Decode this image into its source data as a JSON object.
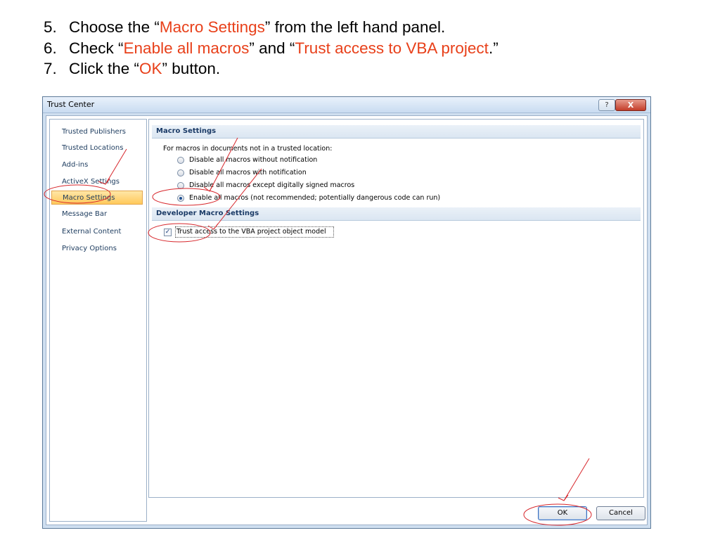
{
  "instructions": [
    {
      "num": "5.",
      "before": "Choose the “",
      "highlight": "Macro Settings",
      "after": "” from the left hand panel."
    },
    {
      "num": "6.",
      "before": "Check “",
      "highlight": "Enable all macros",
      "middle": "” and “",
      "highlight2": "Trust access to VBA project",
      "after": ".”"
    },
    {
      "num": "7.",
      "before": "Click the “",
      "highlight": "OK",
      "after": "” button."
    }
  ],
  "dialog": {
    "title": "Trust Center",
    "help_glyph": "?",
    "close_glyph": "X",
    "nav_items": [
      "Trusted Publishers",
      "Trusted Locations",
      "Add-ins",
      "ActiveX Settings",
      "Macro Settings",
      "Message Bar",
      "External Content",
      "Privacy Options"
    ],
    "selected_nav": "Macro Settings",
    "macro_section_title": "Macro Settings",
    "macro_intro": "For macros in documents not in a trusted location:",
    "macro_options": [
      {
        "label": "Disable all macros without notification",
        "selected": false
      },
      {
        "label": "Disable all macros with notification",
        "selected": false
      },
      {
        "label": "Disable all macros except digitally signed macros",
        "selected": false
      },
      {
        "label": "Enable all macros (not recommended; potentially dangerous code can run)",
        "selected": true
      }
    ],
    "developer_section_title": "Developer Macro Settings",
    "trust_vba_label": "Trust access to the VBA project object model",
    "trust_vba_checked": true,
    "check_glyph": "✓",
    "ok_label": "OK",
    "cancel_label": "Cancel"
  },
  "colors": {
    "highlight_text": "#e8401a",
    "annotation": "#d7262b",
    "selected_nav_bg": "#ffc95b"
  }
}
